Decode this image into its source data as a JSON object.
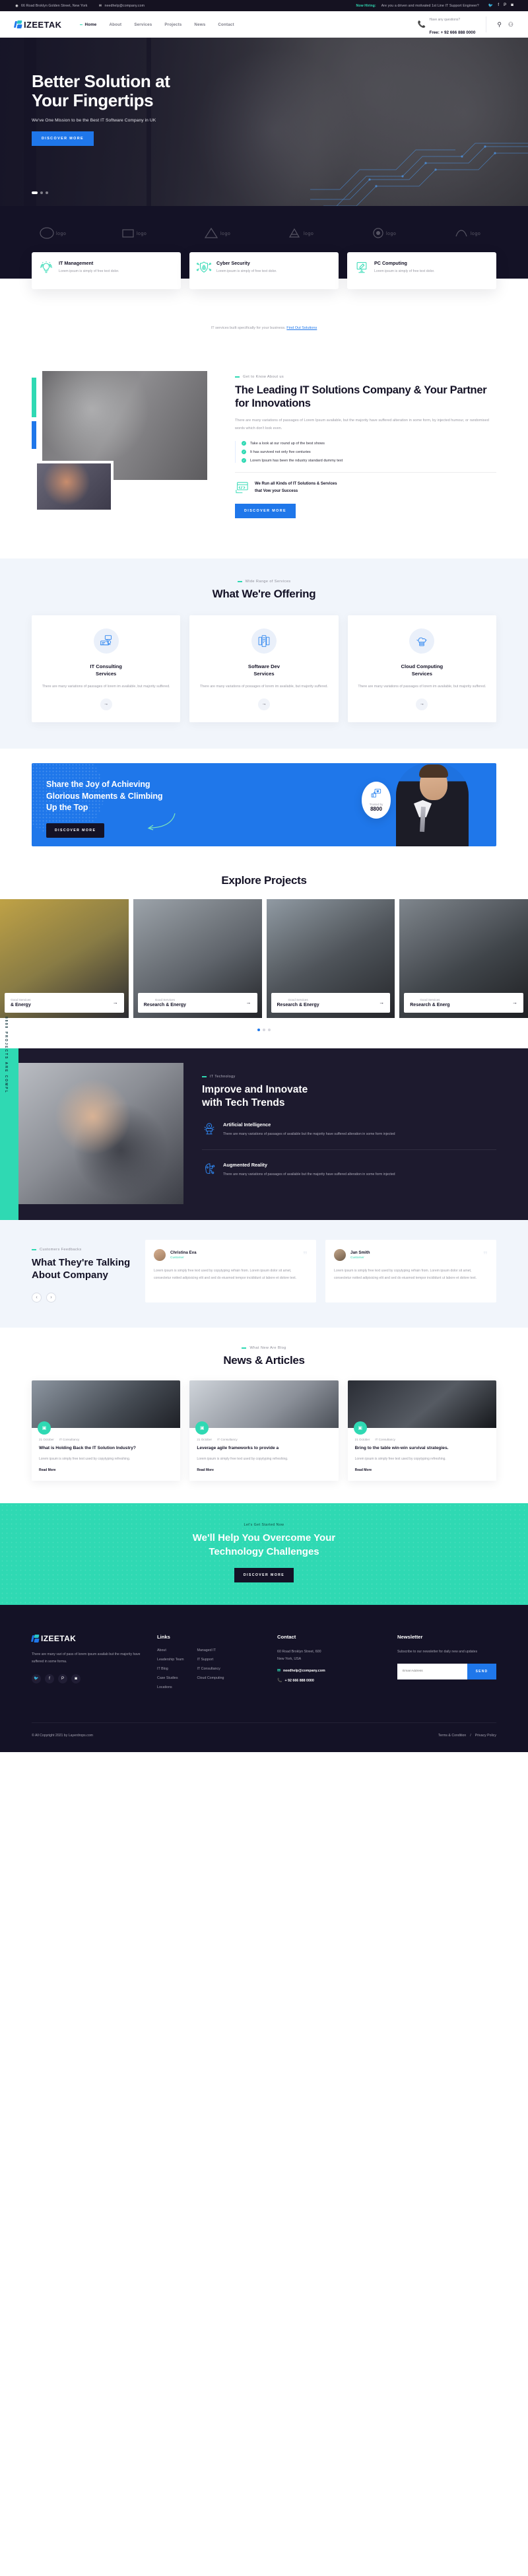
{
  "topbar": {
    "address": "66 Road Broklyn Golden Street, New York",
    "email": "needhelp@company.com",
    "hiring_label": "Now Hiring:",
    "hiring_text": "Are you a driven and motivated 1st Line IT Support Engineer?",
    "socials": [
      "twitter-icon",
      "facebook-icon",
      "pinterest-icon",
      "instagram-icon"
    ]
  },
  "header": {
    "brand": "IZEETAK",
    "nav": [
      {
        "label": "Home",
        "active": true
      },
      {
        "label": "About",
        "active": false
      },
      {
        "label": "Services",
        "active": false
      },
      {
        "label": "Projects",
        "active": false
      },
      {
        "label": "News",
        "active": false
      },
      {
        "label": "Contact",
        "active": false
      }
    ],
    "phone_question": "Have any questions?",
    "phone_number": "Free: + 92 666 888 0000"
  },
  "hero": {
    "title_line1": "Better Solution at",
    "title_line2": "Your Fingertips",
    "subtitle": "We've One Mission to be the Best IT Software Company in UK",
    "button": "DISCOVER MORE",
    "slides": 3,
    "active_slide": 1
  },
  "brands": [
    "brand-logo-1",
    "brand-logo-2",
    "brand-logo-3",
    "brand-logo-4",
    "brand-logo-5",
    "brand-logo-6"
  ],
  "features": {
    "cards": [
      {
        "icon": "lightbulb-network-icon",
        "title": "IT Management",
        "desc": "Lorem ipsum is simply of free text dolor."
      },
      {
        "icon": "shield-lock-icon",
        "title": "Cyber Security",
        "desc": "Lorem ipsum is simply of free text dolor."
      },
      {
        "icon": "monitor-pencil-icon",
        "title": "PC Computing",
        "desc": "Lorem ipsum is simply of free text dolor."
      }
    ],
    "note_text": "IT services built specifically for your business.",
    "note_link": "Find Out Solutions"
  },
  "about": {
    "eyebrow": "Get to Know About us",
    "heading": "The Leading IT Solutions Company & Your Partner for Innovations",
    "paragraph": "There are many variations of passages of Lorem Ipsum available, but the majority have suffered alteration in some form, by injected humour, or randomised words which don't look even.",
    "list": [
      "Take a look at our round up of the best shows",
      "It has survived not only five centuries",
      "Lorem Ipsum has been the ndustry standard dummy text"
    ],
    "run_icon": "code-monitor-icon",
    "run_line1": "We Run all Kinds of IT Solutions & Services",
    "run_line2": "that Vow your Success",
    "button": "DISCOVER MORE"
  },
  "offering": {
    "eyebrow": "Wide Range of Services",
    "heading": "What We're Offering",
    "cards": [
      {
        "icon": "it-consulting-icon",
        "title_line1": "IT Consulting",
        "title_line2": "Services",
        "desc": "There are many variations of passages of lorem im available, but majority suffered."
      },
      {
        "icon": "software-dev-icon",
        "title_line1": "Software Dev",
        "title_line2": "Services",
        "desc": "There are many variations of possages of lorem im available, but majority suffered."
      },
      {
        "icon": "cloud-computing-icon",
        "title_line1": "Cloud Computing",
        "title_line2": "Services",
        "desc": "There are many variations of passages of lorem im available, but majority suffered."
      }
    ],
    "arrow": "→"
  },
  "cta": {
    "heading_line1": "Share the Joy of Achieving",
    "heading_line2": "Glorious Moments & Climbing",
    "heading_line3": "Up the Top",
    "button": "DISCOVER MORE",
    "badge_icon": "thumbs-up-heart-icon",
    "badge_label": "Trusted by",
    "badge_number": "8800"
  },
  "projects": {
    "heading": "Explore Projects",
    "items": [
      {
        "category": "Good Services",
        "title": "& Energy"
      },
      {
        "category": "Good Services",
        "title": "Research & Energy"
      },
      {
        "category": "Good Services",
        "title": "Research & Energy"
      },
      {
        "category": "Good Services",
        "title": "Research & Energ"
      }
    ],
    "arrow": "→",
    "dots": 3,
    "active_dot": 1
  },
  "trends": {
    "side_label": "8888 PROJECTS ARE COMPL",
    "eyebrow": "IT Technology",
    "heading_line1": "Improve and Innovate",
    "heading_line2": "with Tech Trends",
    "items": [
      {
        "icon": "artificial-intelligence-icon",
        "title": "Artificial Intelligence",
        "desc": "There are many variations of passages of available but the majority have suffered alteration in some form injected"
      },
      {
        "icon": "augmented-reality-icon",
        "title": "Augmented Reality",
        "desc": "There are many variations of passages of available but the majority have suffered alteration in some form injected"
      }
    ]
  },
  "testimonials": {
    "eyebrow": "Customers Feedbacks",
    "heading": "What They're Talking About Company",
    "prev": "‹",
    "next": "›",
    "cards": [
      {
        "name": "Christina Eva",
        "role": "Customer",
        "text": "Lorem ipsum is simply free text used by copytyping refrain from. Lorem ipsum dolor sit amet, consectetur notted adipisicing elit and sed do eiusmod tempor incididunt ut labore et dolore text."
      },
      {
        "name": "Jan Smith",
        "role": "Customer",
        "text": "Lorem ipsum is simply free text used by copytyping refrain from. Lorem ipsum dolor sit amet, consectetur notted adipisicing elit and sed do eiusmod tempor incididunt ut labore et dolore text."
      }
    ]
  },
  "news": {
    "eyebrow": "What New Are Blog",
    "heading": "News & Articles",
    "items": [
      {
        "date": "21 October",
        "author": "IT Consultancy",
        "title": "What is Holding Back the IT Solution Industry?",
        "desc": "Lorem ipsum is simply free text used by copytyping refreshing.",
        "more": "Read More",
        "badge": "image-icon"
      },
      {
        "date": "21 October",
        "author": "IT Consultancy",
        "title": "Leverage agile frameworks to provide a",
        "desc": "Lorem ipsum is simply free text used by copytyping refreshing.",
        "more": "Read More",
        "badge": "image-icon"
      },
      {
        "date": "21 October",
        "author": "IT Consultancy",
        "title": "Bring to the table win-win survival strategies.",
        "desc": "Lorem ipsum is simply free text used by copytyping refreshing.",
        "more": "Read More",
        "badge": "image-icon"
      }
    ]
  },
  "green_cta": {
    "eyebrow": "Let's Get Started Now",
    "heading_line1": "We'll Help You Overcome Your",
    "heading_line2": "Technology Challenges",
    "button": "DISCOVER MORE"
  },
  "footer": {
    "brand": "IZEETAK",
    "desc": "There are many vari of pass of lorem ipsum availab but the majority have suffered in some forma.",
    "socials": [
      "twitter-icon",
      "facebook-icon",
      "pinterest-icon",
      "instagram-icon"
    ],
    "links_heading": "Links",
    "links_col1": [
      "About",
      "Leadership Team",
      "IT Blog",
      "Case Studies",
      "Locations"
    ],
    "links_col2": [
      "Managed IT",
      "IT Support",
      "IT Consultancy",
      "Cloud Computing"
    ],
    "contact_heading": "Contact",
    "contact_address_line1": "60 Road Broklyn Street, 600",
    "contact_address_line2": "New York, USA",
    "contact_email": "needhelp@company.com",
    "contact_phone": "+ 92 666 888 0000",
    "newsletter_heading": "Newsletter",
    "newsletter_desc": "Subscribe to our newsletter for daily new and updates",
    "newsletter_placeholder": "Email Address",
    "newsletter_button": "SEND",
    "copyright": "© All Copyright 2021 by Layerdrops.com",
    "terms": "Terms & Condition",
    "divider": "/",
    "privacy": "Privacy Policy"
  },
  "colors": {
    "primary_blue": "#1f77ea",
    "accent_teal": "#2fd9b3",
    "dark": "#141226"
  }
}
